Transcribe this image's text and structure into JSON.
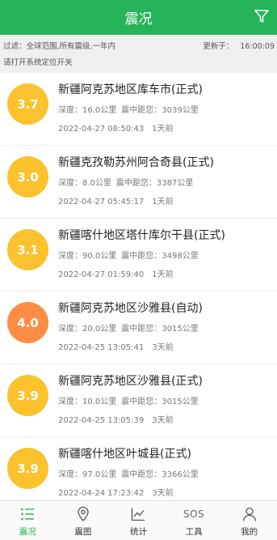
{
  "header": {
    "title": "震况",
    "filter_icon": "filter-icon"
  },
  "info": {
    "filter_text": "过滤：全球范围,所有震级,一年内",
    "update_label": "更新于：",
    "update_time": "16:00:09",
    "locate_tip": "请打开系统定位开关"
  },
  "quakes": [
    {
      "magnitude": "3.7",
      "location": "新疆阿克苏地区库车市(正式)",
      "depth": "深度：16.0公里",
      "distance": "震中距您：3039公里",
      "datetime": "2022-04-27 08:50:43",
      "ago": "1天前"
    },
    {
      "magnitude": "3.0",
      "location": "新疆克孜勒苏州阿合奇县(正式)",
      "depth": "深度：8.0公里",
      "distance": "震中距您：3387公里",
      "datetime": "2022-04-27 05:45:17",
      "ago": "1天前"
    },
    {
      "magnitude": "3.1",
      "location": "新疆喀什地区塔什库尔干县(正式)",
      "depth": "深度：90.0公里",
      "distance": "震中距您：3498公里",
      "datetime": "2022-04-27 01:59:40",
      "ago": "1天前"
    },
    {
      "magnitude": "4.0",
      "location": "新疆阿克苏地区沙雅县(自动)",
      "depth": "深度：20.0公里",
      "distance": "震中距您：3015公里",
      "datetime": "2022-04-25 13:05:41",
      "ago": "3天前"
    },
    {
      "magnitude": "3.9",
      "location": "新疆阿克苏地区沙雅县(正式)",
      "depth": "深度：10.0公里",
      "distance": "震中距您：3015公里",
      "datetime": "2022-04-25 13:05:39",
      "ago": "3天前"
    },
    {
      "magnitude": "3.9",
      "location": "新疆喀什地区叶城县(正式)",
      "depth": "深度：97.0公里",
      "distance": "震中距您：3366公里",
      "datetime": "2022-04-24 17:23:42",
      "ago": "3天前"
    }
  ],
  "colors": {
    "brand": "#27b35a",
    "mag_yellow": "#fbc22e",
    "mag_orange": "#fd8d44"
  },
  "tabs": [
    {
      "label": "震况",
      "icon": "list-icon",
      "active": true
    },
    {
      "label": "震图",
      "icon": "map-pin-icon"
    },
    {
      "label": "统计",
      "icon": "line-chart-icon"
    },
    {
      "label": "工具",
      "icon": "sos-icon",
      "icon_text": "SOS"
    },
    {
      "label": "我的",
      "icon": "user-icon"
    }
  ]
}
